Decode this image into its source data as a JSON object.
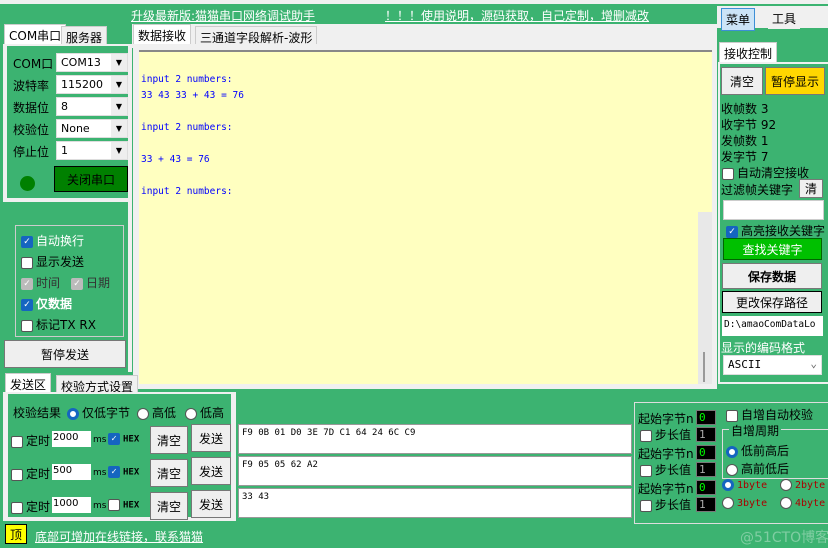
{
  "header": {
    "upgrade_link": "升级最新版:猫猫串口网络调试助手",
    "help_link": "！！！使用说明，源码获取，自己定制，增删减改"
  },
  "menu_tabs": [
    "菜单",
    "工具"
  ],
  "left_tabs": [
    "COM串口",
    "服务器"
  ],
  "serial": {
    "fields": [
      {
        "label": "COM口",
        "value": "COM13"
      },
      {
        "label": "波特率",
        "value": "115200"
      },
      {
        "label": "数据位",
        "value": "8"
      },
      {
        "label": "校验位",
        "value": "None"
      },
      {
        "label": "停止位",
        "value": "1"
      }
    ],
    "close_button": "关闭串口",
    "status_color": "#008000"
  },
  "options": {
    "auto_newline": "自动换行",
    "show_send": "显示发送",
    "time": "时间",
    "date": "日期",
    "data_only": "仅数据",
    "mark_txrx": "标记TX RX"
  },
  "pause_send": "暂停发送",
  "main_tabs": [
    "数据接收",
    "三通道字段解析-波形"
  ],
  "receive_lines": [
    "",
    "input 2 numbers:",
    "33 43 33 + 43 = 76",
    "",
    "input 2 numbers:",
    "",
    "33 + 43 = 76",
    "",
    "input 2 numbers:"
  ],
  "recv_ctrl": {
    "tab": "接收控制",
    "clear": "清空",
    "pause_display": "暂停显示",
    "stats": [
      {
        "label": "收帧数",
        "value": "3"
      },
      {
        "label": "收字节",
        "value": "92"
      },
      {
        "label": "发帧数",
        "value": "1"
      },
      {
        "label": "发字节",
        "value": "7"
      }
    ],
    "auto_clear": "自动清空接收",
    "filter_label": "过滤帧关键字",
    "filter_clear": "清",
    "filter_value": "",
    "highlight": "高亮接收关键字",
    "find": "查找关键字",
    "save": "保存数据",
    "change_path": "更改保存路径",
    "path": "D:\\amaoComDataLo",
    "encoding_label": "显示的编码格式",
    "encoding": "ASCII"
  },
  "send_tabs": [
    "发送区",
    "校验方式设置"
  ],
  "checksum": {
    "label": "校验结果",
    "options": [
      "仅低字节",
      "高低",
      "低高"
    ]
  },
  "send_rows": [
    {
      "timer_label": "定时",
      "interval": "2000",
      "unit": "ms",
      "hex_label": "HEX",
      "hex": true,
      "clear": "清空",
      "send": "发送",
      "content": "F9 0B 01 D0 3E 7D C1 64 24 6C C9"
    },
    {
      "timer_label": "定时",
      "interval": "500",
      "unit": "ms",
      "hex_label": "HEX",
      "hex": true,
      "clear": "清空",
      "send": "发送",
      "content": "F9 05 05 62 A2"
    },
    {
      "timer_label": "定时",
      "interval": "1000",
      "unit": "ms",
      "hex_label": "HEX",
      "hex": false,
      "clear": "清空",
      "send": "发送",
      "content": "33 43"
    }
  ],
  "auto_inc": {
    "start_label": "起始字节n",
    "step_label": "步长值",
    "rows": [
      {
        "start": "0",
        "step": "1"
      },
      {
        "start": "0",
        "step": "1"
      },
      {
        "start": "0",
        "step": "1"
      }
    ],
    "auto_check": "自增自动校验",
    "period_title": "自增周期",
    "period_options": [
      "低前高后",
      "高前低后"
    ],
    "byte_options": [
      "1byte",
      "2byte",
      "3byte",
      "4byte"
    ]
  },
  "footer": {
    "top_button": "顶",
    "link": "底部可增加在线链接，联系猫猫"
  },
  "watermark": "@51CTO博客"
}
